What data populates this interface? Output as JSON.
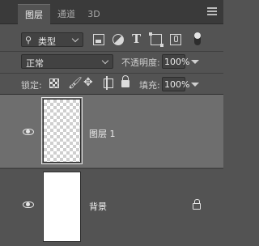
{
  "tabs": [
    {
      "label": "图层",
      "active": true
    },
    {
      "label": "通道",
      "active": false
    },
    {
      "label": "3D",
      "active": false
    }
  ],
  "filter": {
    "kind_label": "类型",
    "icons": [
      "image-filter-icon",
      "adjustment-filter-icon",
      "type-filter-icon",
      "shape-filter-icon",
      "smart-object-filter-icon"
    ],
    "toggle_on": true
  },
  "blend": {
    "mode": "正常",
    "opacity_label": "不透明度:",
    "opacity_value": "100%"
  },
  "lock": {
    "label": "锁定:",
    "icons": [
      "lock-transparent-pixels-icon",
      "lock-image-pixels-icon",
      "lock-position-icon",
      "lock-artboard-icon",
      "lock-all-icon"
    ],
    "fill_label": "填充:",
    "fill_value": "100%"
  },
  "layers": [
    {
      "name": "图层 1",
      "selected": true,
      "visible": true,
      "locked": false,
      "thumbnail": "transparent"
    },
    {
      "name": "背景",
      "selected": false,
      "visible": true,
      "locked": true,
      "thumbnail": "white"
    }
  ],
  "colors": {
    "panel_bg": "#535353",
    "tabbar_bg": "#3a3a3a",
    "selected_row": "#6e6e6e",
    "field_bg": "#424242"
  }
}
